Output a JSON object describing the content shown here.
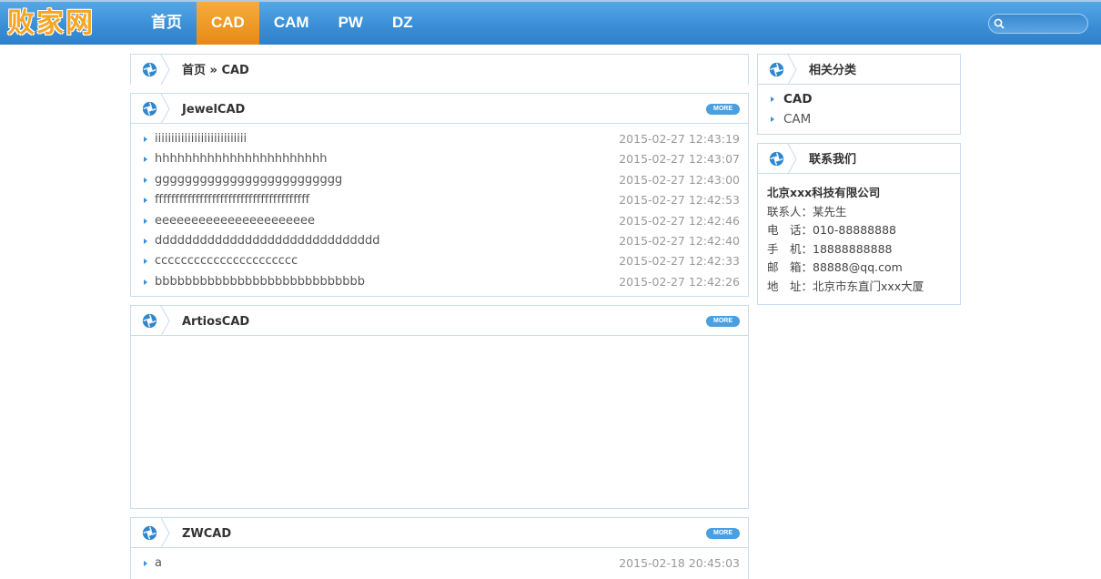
{
  "header": {
    "logo_text": "败家网",
    "nav": [
      {
        "label": "首页",
        "active": false
      },
      {
        "label": "CAD",
        "active": true
      },
      {
        "label": "CAM",
        "active": false
      },
      {
        "label": "PW",
        "active": false
      },
      {
        "label": "DZ",
        "active": false
      }
    ],
    "search_placeholder": ""
  },
  "breadcrumb": {
    "text": "首页 » CAD"
  },
  "sections": [
    {
      "title": "JewelCAD",
      "more_label": "MORE",
      "items": [
        {
          "text": "iiiiiiiiiiiiiiiiiiiiiiiiiiii",
          "date": "2015-02-27 12:43:19"
        },
        {
          "text": "hhhhhhhhhhhhhhhhhhhhhhh",
          "date": "2015-02-27 12:43:07"
        },
        {
          "text": "ggggggggggggggggggggggggg",
          "date": "2015-02-27 12:43:00"
        },
        {
          "text": "ffffffffffffffffffffffffffffffffffffff",
          "date": "2015-02-27 12:42:53"
        },
        {
          "text": "eeeeeeeeeeeeeeeeeeeeee",
          "date": "2015-02-27 12:42:46"
        },
        {
          "text": "dddddddddddddddddddddddddddddd",
          "date": "2015-02-27 12:42:40"
        },
        {
          "text": "cccccccccccccccccccccc",
          "date": "2015-02-27 12:42:33"
        },
        {
          "text": "bbbbbbbbbbbbbbbbbbbbbbbbbbbb",
          "date": "2015-02-27 12:42:26"
        }
      ]
    },
    {
      "title": "ArtiosCAD",
      "more_label": "MORE",
      "items": []
    },
    {
      "title": "ZWCAD",
      "more_label": "MORE",
      "items": [
        {
          "text": "a",
          "date": "2015-02-18 20:45:03"
        }
      ]
    }
  ],
  "sidebar": {
    "related": {
      "title": "相关分类",
      "items": [
        {
          "label": "CAD",
          "current": true
        },
        {
          "label": "CAM",
          "current": false
        }
      ]
    },
    "contact": {
      "title": "联系我们",
      "company": "北京xxx科技有限公司",
      "lines": [
        "联系人：某先生",
        "电　话：010-88888888",
        "手　机：18888888888",
        "邮　箱：88888@qq.com",
        "地　址：北京市东直门xxx大厦"
      ]
    }
  },
  "colors": {
    "header_blue": "#3b8fd6",
    "nav_active": "#f0a030",
    "border": "#c8dcee",
    "accent": "#3a8fd6",
    "logo": "#f6a623"
  },
  "icons": {
    "panel_head": "aperture-icon",
    "search": "search-icon",
    "bullet": "triangle-bullet-icon"
  }
}
